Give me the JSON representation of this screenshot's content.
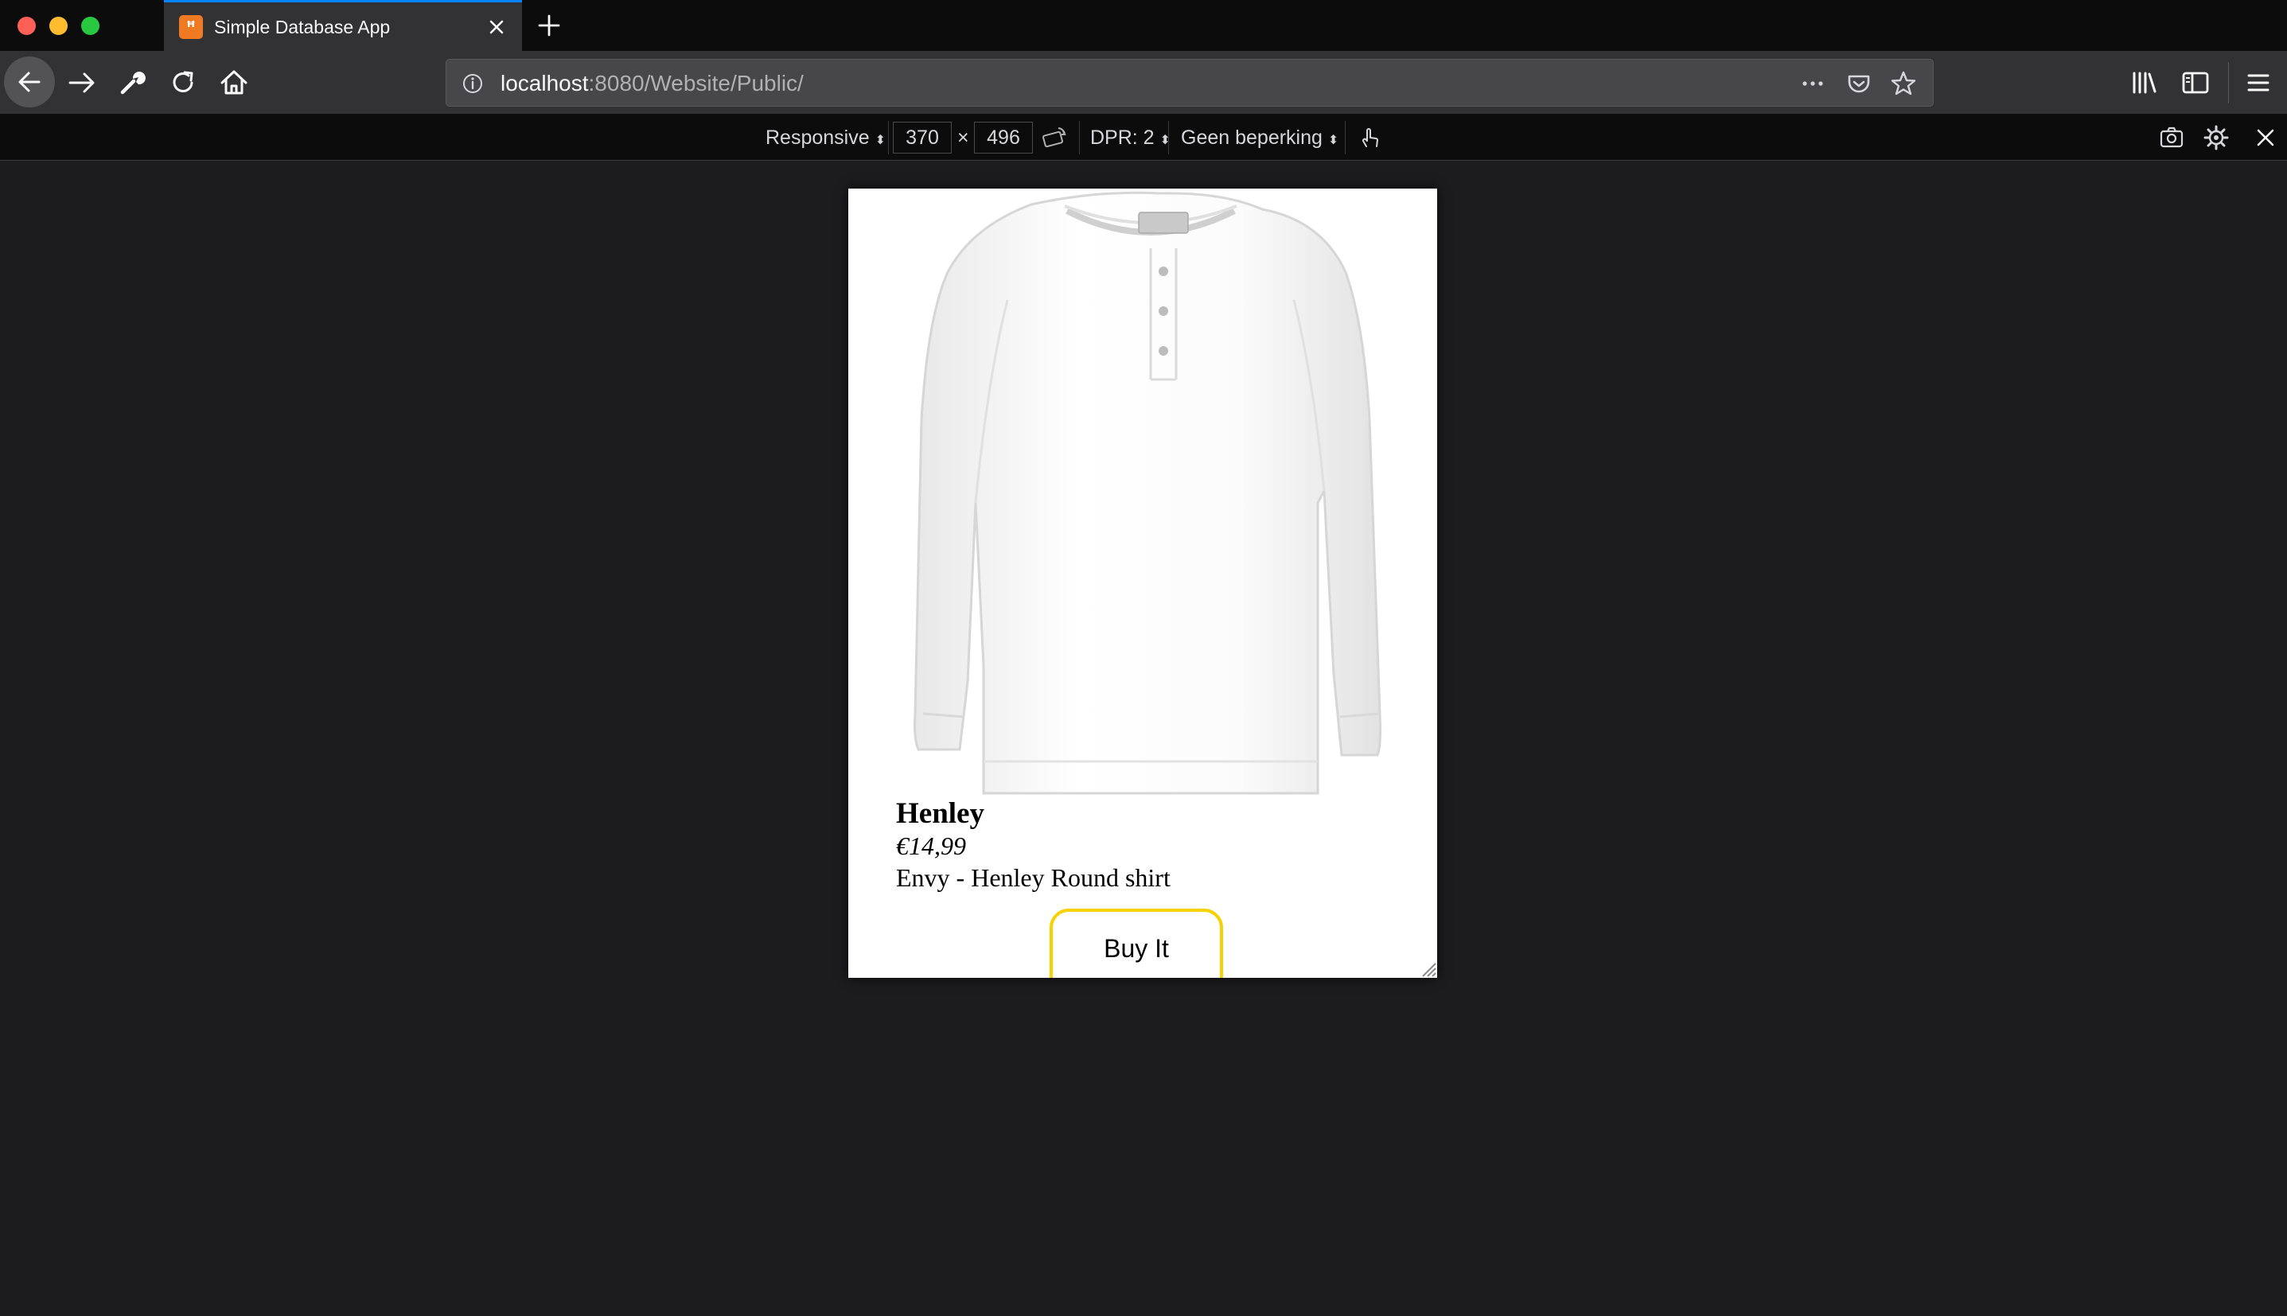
{
  "browser": {
    "tab": {
      "title": "Simple Database App",
      "favicon": "xampp-icon"
    },
    "url": {
      "host": "localhost",
      "rest": ":8080/Website/Public/"
    },
    "accent": "#0a84ff"
  },
  "responsive_toolbar": {
    "device": "Responsive",
    "width": "370",
    "times": "×",
    "height": "496",
    "dpr": "DPR: 2",
    "throttling": "Geen beperking"
  },
  "product": {
    "name": "Henley",
    "price": "€14,99",
    "description": "Envy - Henley Round shirt",
    "buy_label": "Buy It",
    "button_color": "#f8d200"
  }
}
